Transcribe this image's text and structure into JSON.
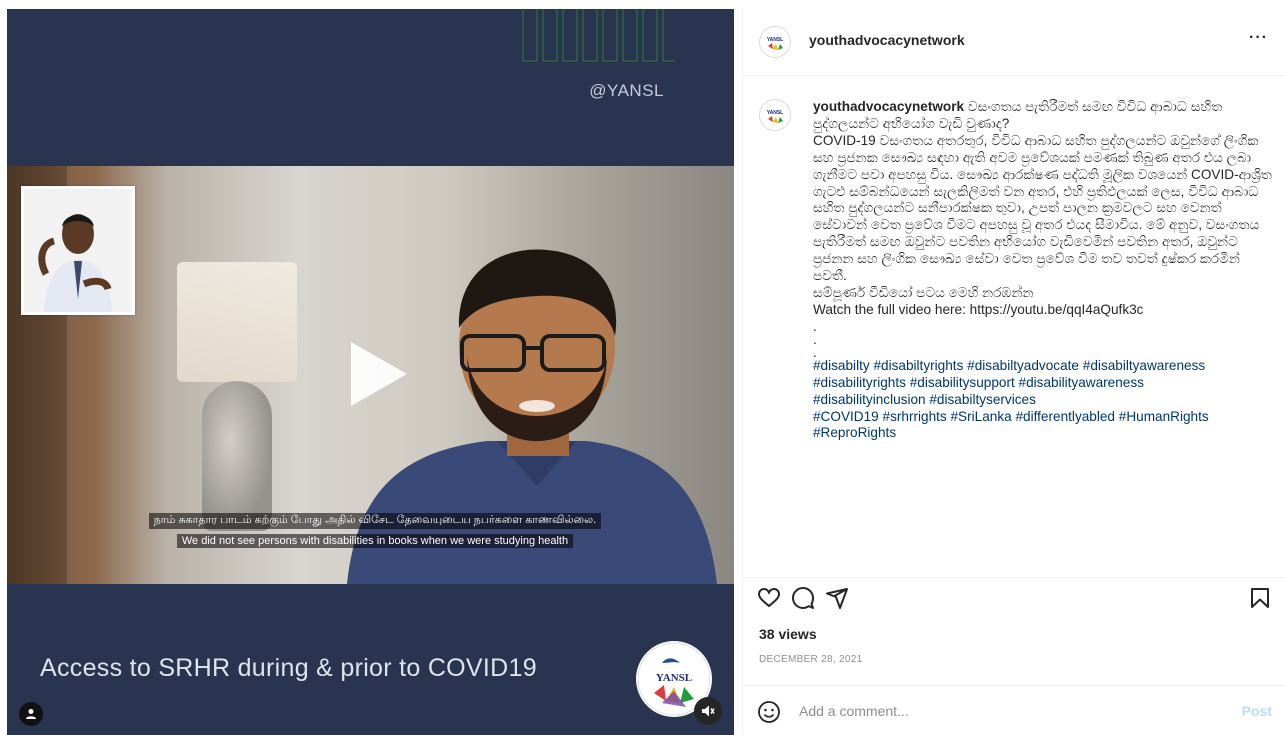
{
  "media": {
    "handle": "@YANSL",
    "title": "Access to SRHR during & prior to COVID19",
    "subtitle_tamil": "நாம் சுகாதார பாடம் கற்கும் போது அதில் விசேட தேவையுடைய நபர்களை காணவில்லை.",
    "subtitle_english": "We did not see persons with disabilities in books when we were studying health",
    "logo_text": "YANSL",
    "colors": {
      "background": "#293451",
      "accent_lines": "#2e7d32"
    }
  },
  "post": {
    "username": "youthadvocacynetwork",
    "more_label": "···",
    "caption_lines": [
      "වසංගතය පැතිරීමත් සමඟ විවිධ ආබාධ සහිත පුද්ගලයන්ට අභියෝග වැඩි වුණාද?",
      "COVID-19 වසංගතය අතරතුර, විවිධ ආබාධ සහිත පුද්ගලයන්ට ඔවුන්ගේ ලිංගික සහ ප්‍රජනක සෞඛ්‍ය සඳහා ඇති අවම ප්‍රවේශයක් පමණක් තිබුණ අතර එය ලබා ගැනීමට පවා අපහසු විය. සෞඛ්‍ය ආරක්ෂණ පද්ධති මූලික වශයෙන් COVID-ආශ්‍රිත ගැටළු සම්බන්ධයෙන් සැලකිලිමත් වන අතර, එහි ප්‍රතිඵලයක් ලෙස, විවිධ ආබාධ සහිත පුද්ගලයන්ට සනීපාරක්ෂක තුවා, උපත් පාලන ක්‍රමවලට සහ වෙනත් සේවාවන් වෙත ප්‍රවේශ වීමට අපහසු වූ අතර එයද සීමාවිය. මේ අනුව, වසංගතය පැතිරීමත් සමඟ ඔවුන්ට පවතින අභියෝග වැඩිවෙමින් පවතින අතර, ඔවුන්ට ප්‍රජනන සහ ලිංගික සෞඛ්‍ය සේවා වෙත ප්‍රවේශ වීම තව තවත් දුෂ්කර කරමින් පවතී.",
      "සම්පූර්ණ වීඩියෝ පටය මෙහි නරඹන්න",
      "Watch the full video here: https://youtu.be/qqI4aQufk3c"
    ],
    "dots": [
      ".",
      ".",
      "."
    ],
    "hashtag_lines": [
      "#disabilty #disabiltyrights #disabiltyadvocate #disabiltyawareness",
      "#disabilityrights #disabilitysupport #disabilityawareness",
      "#disabilityinclusion #disabiltyservices",
      "#COVID19 #srhrrights #SriLanka #differentlyabled #HumanRights",
      "#ReproRights"
    ],
    "views": "38 views",
    "date": "DECEMBER 28, 2021",
    "comment_placeholder": "Add a comment...",
    "post_label": "Post",
    "icons": [
      "heart-icon",
      "comment-icon",
      "share-icon",
      "bookmark-icon",
      "emoji-icon"
    ]
  }
}
